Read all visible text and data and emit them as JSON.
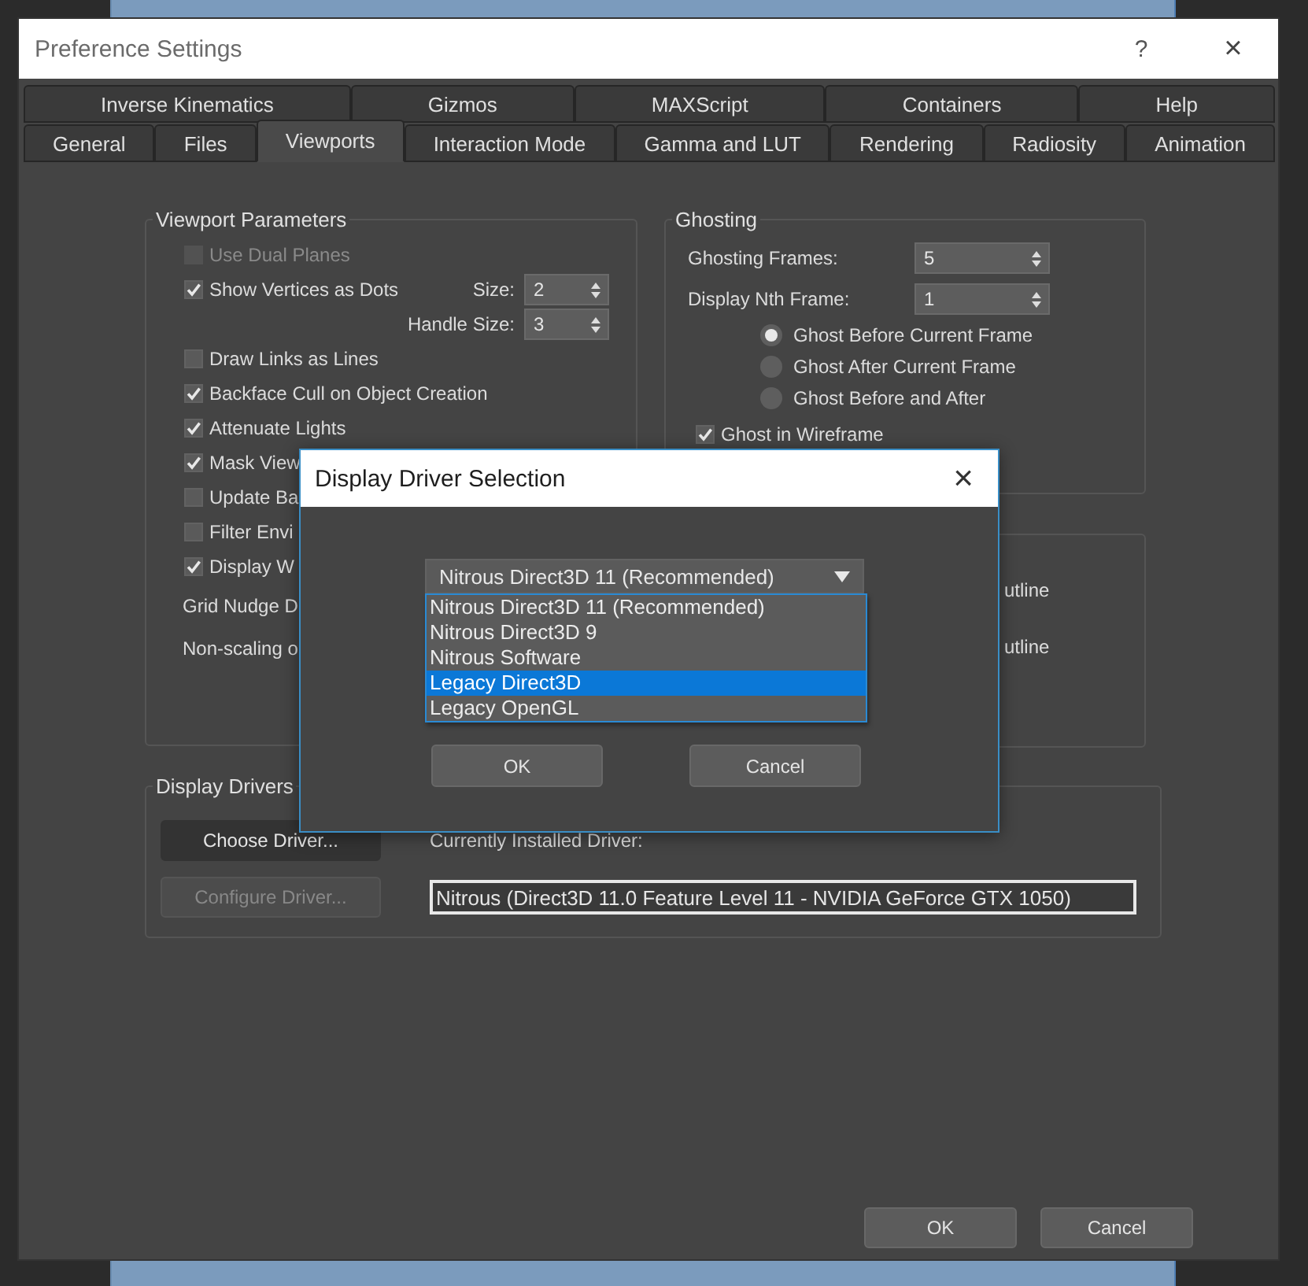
{
  "window": {
    "title": "Preference Settings",
    "help": "?",
    "close": "×"
  },
  "tab_rows": [
    {
      "tabs": [
        {
          "label": "Inverse Kinematics",
          "selected": false
        },
        {
          "label": "Gizmos",
          "selected": false
        },
        {
          "label": "MAXScript",
          "selected": false
        },
        {
          "label": "Containers",
          "selected": false
        },
        {
          "label": "Help",
          "selected": false
        }
      ]
    },
    {
      "tabs": [
        {
          "label": "General",
          "selected": false
        },
        {
          "label": "Files",
          "selected": false
        },
        {
          "label": "Viewports",
          "selected": true
        },
        {
          "label": "Interaction Mode",
          "selected": false
        },
        {
          "label": "Gamma and LUT",
          "selected": false
        },
        {
          "label": "Rendering",
          "selected": false
        },
        {
          "label": "Radiosity",
          "selected": false
        },
        {
          "label": "Animation",
          "selected": false
        }
      ]
    }
  ],
  "viewport_parameters": {
    "title": "Viewport Parameters",
    "items": [
      {
        "kind": "checkbox",
        "label": "Use Dual Planes",
        "checked": false,
        "disabled": true
      },
      {
        "kind": "checkbox",
        "label": "Show Vertices as Dots",
        "checked": true,
        "disabled": false,
        "spinner": {
          "label": "Size:",
          "value": "2"
        }
      },
      {
        "kind": "spinner",
        "label": "Handle Size:",
        "value": "3"
      },
      {
        "kind": "checkbox",
        "label": "Draw Links as Lines",
        "checked": false,
        "disabled": false
      },
      {
        "kind": "checkbox",
        "label": "Backface Cull on Object Creation",
        "checked": true,
        "disabled": false
      },
      {
        "kind": "checkbox",
        "label": "Attenuate Lights",
        "checked": true,
        "disabled": false
      },
      {
        "kind": "checkbox",
        "label": "Mask View",
        "checked": true,
        "disabled": false
      },
      {
        "kind": "checkbox",
        "label": "Update Ba",
        "checked": false,
        "disabled": false
      },
      {
        "kind": "checkbox",
        "label": "Filter Envi",
        "checked": false,
        "disabled": false
      },
      {
        "kind": "checkbox",
        "label": "Display W",
        "checked": true,
        "disabled": false
      },
      {
        "kind": "text",
        "label": "Grid Nudge D"
      },
      {
        "kind": "text",
        "label": "Non-scaling o"
      }
    ]
  },
  "ghosting": {
    "title": "Ghosting",
    "spinners": [
      {
        "label": "Ghosting Frames:",
        "value": "5"
      },
      {
        "label": "Display Nth Frame:",
        "value": "1"
      }
    ],
    "radios": [
      {
        "label": "Ghost Before Current Frame",
        "selected": true
      },
      {
        "label": "Ghost After Current Frame",
        "selected": false
      },
      {
        "label": "Ghost Before and After",
        "selected": false
      }
    ],
    "checkbox": {
      "label": "Ghost in Wireframe",
      "checked": true
    }
  },
  "hidden_group": {
    "items": [
      "utline",
      "utline"
    ]
  },
  "display_drivers": {
    "title": "Display Drivers",
    "choose_button": "Choose Driver...",
    "configure_button": "Configure Driver...",
    "configure_disabled": true,
    "installed_label": "Currently Installed Driver:",
    "installed_value": "Nitrous (Direct3D 11.0 Feature Level 11 - NVIDIA GeForce GTX 1050)"
  },
  "buttons": [
    "OK",
    "Cancel"
  ],
  "dialog": {
    "title": "Display Driver Selection",
    "close": "×",
    "dropdown": {
      "value": "Nitrous Direct3D 11 (Recommended)",
      "options": [
        {
          "label": "Nitrous Direct3D 11 (Recommended)",
          "highlighted": false
        },
        {
          "label": "Nitrous Direct3D 9",
          "highlighted": false
        },
        {
          "label": "Nitrous Software",
          "highlighted": false
        },
        {
          "label": "Legacy Direct3D",
          "highlighted": true
        },
        {
          "label": "Legacy OpenGL",
          "highlighted": false
        }
      ]
    },
    "buttons": [
      "OK",
      "Cancel"
    ]
  }
}
